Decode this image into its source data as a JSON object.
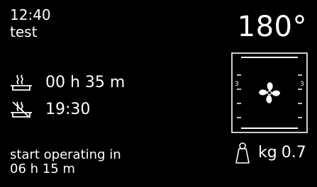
{
  "clock": "12:40",
  "program_name": "test",
  "temperature": "180°",
  "duration": {
    "icon": "cooking-duration-icon",
    "value": "00 h 35 m"
  },
  "end_time": {
    "icon": "end-time-icon",
    "value": "19:30"
  },
  "start": {
    "label": "start operating in",
    "value": "06 h 15 m"
  },
  "oven": {
    "icon": "fan-icon",
    "left_level": "3",
    "right_level": "3"
  },
  "weight": {
    "icon": "weight-icon",
    "unit": "kg",
    "value": "0.7"
  }
}
